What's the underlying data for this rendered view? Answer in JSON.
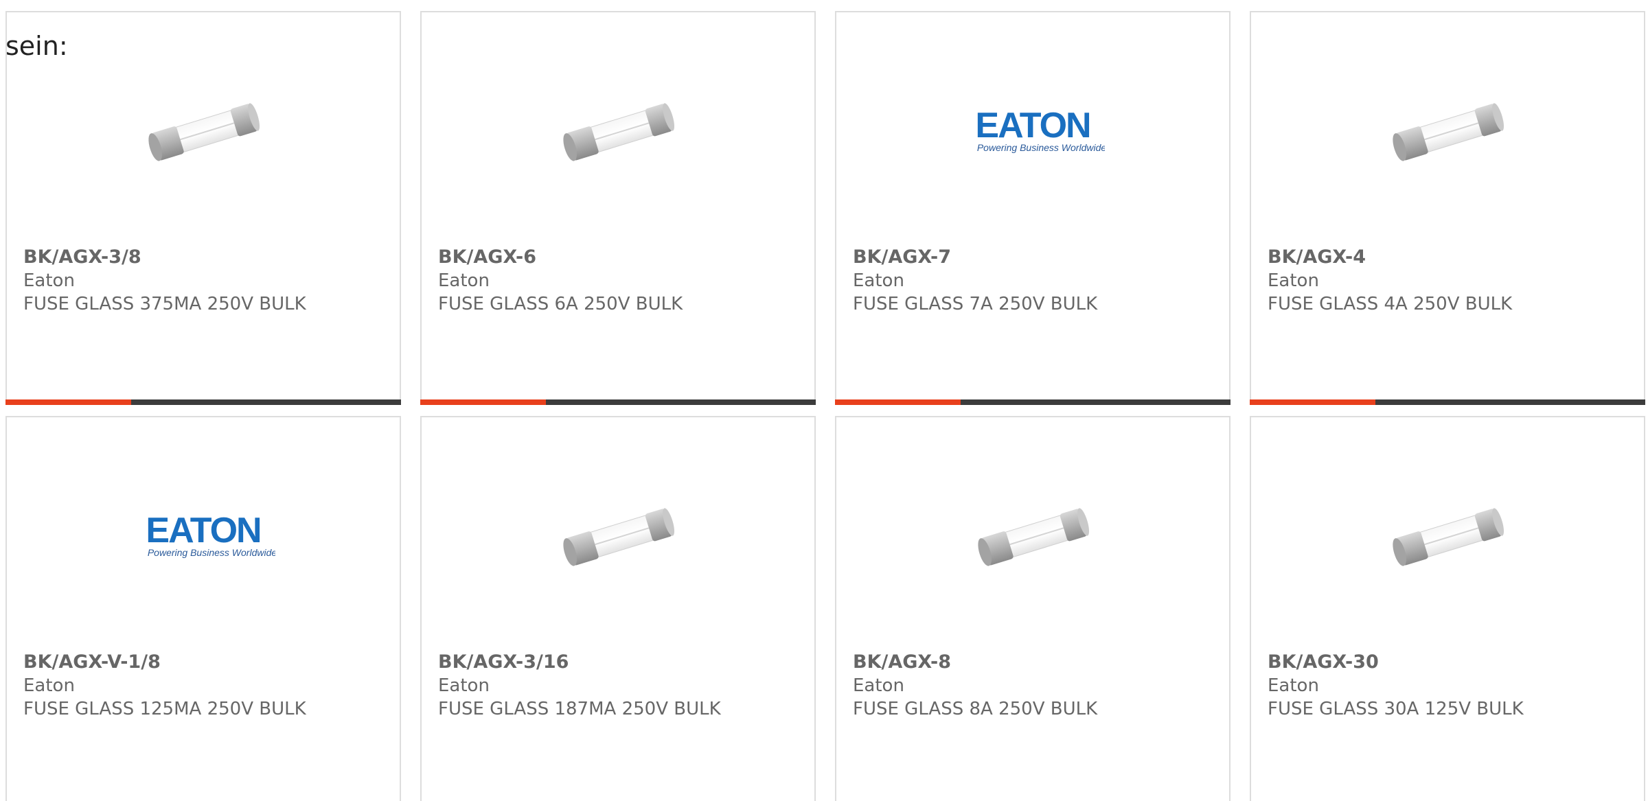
{
  "intro_text": "sein:",
  "colors": {
    "accent": "#e8401c",
    "bar_dark": "#3c3c3c",
    "eaton_blue": "#1a6fc0",
    "text": "#666666"
  },
  "eaton_logo": {
    "wordmark": "EATON",
    "tagline": "Powering Business Worldwide"
  },
  "products": [
    {
      "part": "BK/AGX-3/8",
      "manufacturer": "Eaton",
      "description": "FUSE GLASS 375MA 250V BULK",
      "image": "fuse-image"
    },
    {
      "part": "BK/AGX-6",
      "manufacturer": "Eaton",
      "description": "FUSE GLASS 6A 250V BULK",
      "image": "fuse-image"
    },
    {
      "part": "BK/AGX-7",
      "manufacturer": "Eaton",
      "description": "FUSE GLASS 7A 250V BULK",
      "image": "eaton-logo"
    },
    {
      "part": "BK/AGX-4",
      "manufacturer": "Eaton",
      "description": "FUSE GLASS 4A 250V BULK",
      "image": "fuse-image"
    },
    {
      "part": "BK/AGX-V-1/8",
      "manufacturer": "Eaton",
      "description": "FUSE GLASS 125MA 250V BULK",
      "image": "eaton-logo"
    },
    {
      "part": "BK/AGX-3/16",
      "manufacturer": "Eaton",
      "description": "FUSE GLASS 187MA 250V BULK",
      "image": "fuse-image"
    },
    {
      "part": "BK/AGX-8",
      "manufacturer": "Eaton",
      "description": "FUSE GLASS 8A 250V BULK",
      "image": "fuse-image"
    },
    {
      "part": "BK/AGX-30",
      "manufacturer": "Eaton",
      "description": "FUSE GLASS 30A 125V BULK",
      "image": "fuse-image"
    }
  ]
}
